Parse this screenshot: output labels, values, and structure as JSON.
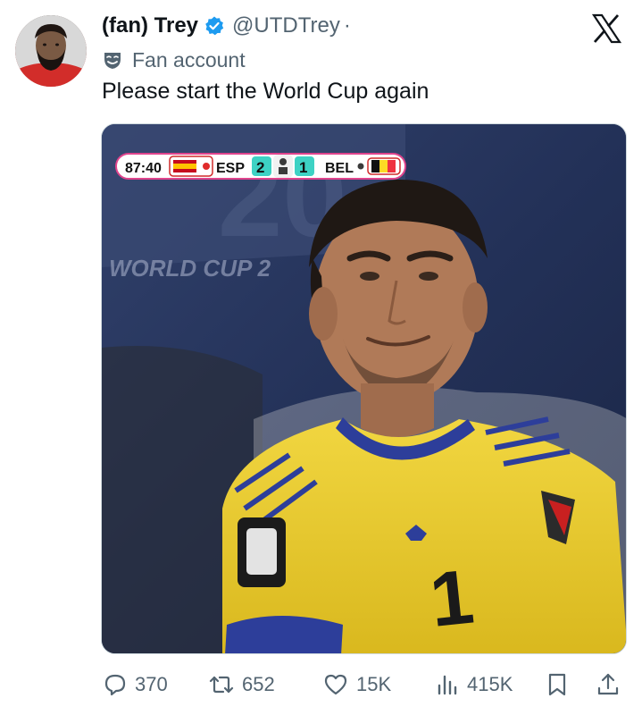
{
  "author": {
    "display_name": "(fan) Trey",
    "handle": "@UTDTrey",
    "separator": "·",
    "label": "Fan account"
  },
  "tweet": {
    "text": "Please start the World Cup again"
  },
  "media": {
    "scoreboard": {
      "time": "87:40",
      "home_team": "ESP",
      "home_score": "2",
      "away_score": "1",
      "away_team": "BEL"
    },
    "background_text": "WORLD CUP 2",
    "jersey_number": "1"
  },
  "actions": {
    "replies": "370",
    "reposts": "652",
    "likes": "15K",
    "views": "415K"
  },
  "icons": {
    "verified": "verified-badge-icon",
    "platform": "x-logo-icon",
    "label": "mask-icon",
    "reply": "reply-icon",
    "repost": "repost-icon",
    "like": "heart-icon",
    "views": "views-icon",
    "bookmark": "bookmark-icon",
    "share": "share-icon"
  },
  "colors": {
    "verified_blue": "#1d9bf0",
    "text_primary": "#0f1419",
    "text_secondary": "#536471"
  }
}
